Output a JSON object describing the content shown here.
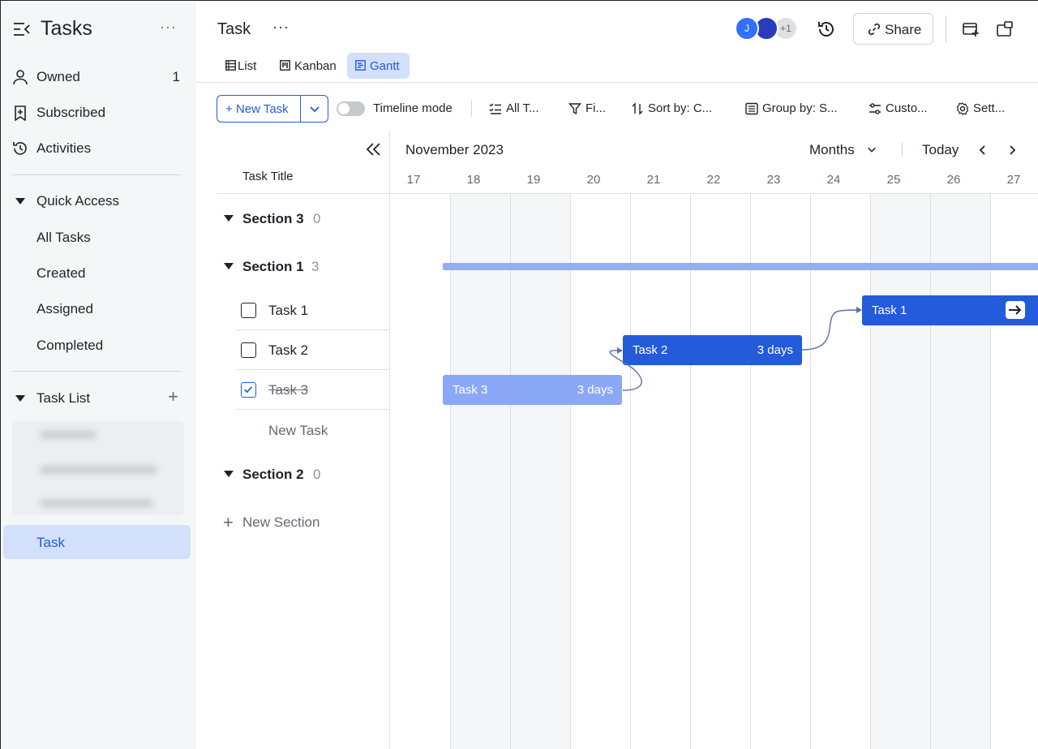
{
  "sidebar": {
    "title": "Tasks",
    "more": "···",
    "owned": {
      "label": "Owned",
      "count": "1"
    },
    "subscribed": {
      "label": "Subscribed"
    },
    "activities": {
      "label": "Activities"
    },
    "quick_access": {
      "label": "Quick Access",
      "items": [
        "All Tasks",
        "Created",
        "Assigned",
        "Completed"
      ]
    },
    "task_list": {
      "label": "Task List",
      "add": "+"
    },
    "active_item": "Task"
  },
  "header": {
    "title": "Task",
    "more": "···",
    "avatars": [
      "J",
      "",
      "+1"
    ],
    "share_label": "Share"
  },
  "views": [
    "List",
    "Kanban",
    "Gantt"
  ],
  "active_view": "Gantt",
  "toolbar": {
    "new_task": "New Task",
    "timeline_mode": "Timeline mode",
    "all_tasks": "All T...",
    "filter": "Fi...",
    "sort": "Sort by: C...",
    "group": "Group by: S...",
    "customize": "Custo...",
    "settings": "Sett..."
  },
  "table": {
    "column_title": "Task Title",
    "sections": [
      {
        "name": "Section 3",
        "count": "0"
      },
      {
        "name": "Section 1",
        "count": "3",
        "tasks": [
          {
            "name": "Task 1",
            "done": false
          },
          {
            "name": "Task 2",
            "done": false
          },
          {
            "name": "Task 3",
            "done": true
          }
        ]
      },
      {
        "name": "Section 2",
        "count": "0"
      }
    ],
    "new_task": "New Task",
    "new_section": "New Section"
  },
  "gantt": {
    "month": "November 2023",
    "scale": "Months",
    "today": "Today",
    "days": [
      "17",
      "18",
      "19",
      "20",
      "21",
      "22",
      "23",
      "24",
      "25",
      "26",
      "27"
    ],
    "weekend_days": [
      "18",
      "19",
      "25",
      "26"
    ],
    "bars": [
      {
        "name": "Task 2",
        "duration": "3 days"
      },
      {
        "name": "Task 3",
        "duration": "3 days"
      },
      {
        "name": "Task 1"
      }
    ]
  },
  "colors": {
    "accent": "#245bdb",
    "bar": "#245bdb",
    "bar_done": "#8aa8f5",
    "section_bar": "#94adf7"
  }
}
